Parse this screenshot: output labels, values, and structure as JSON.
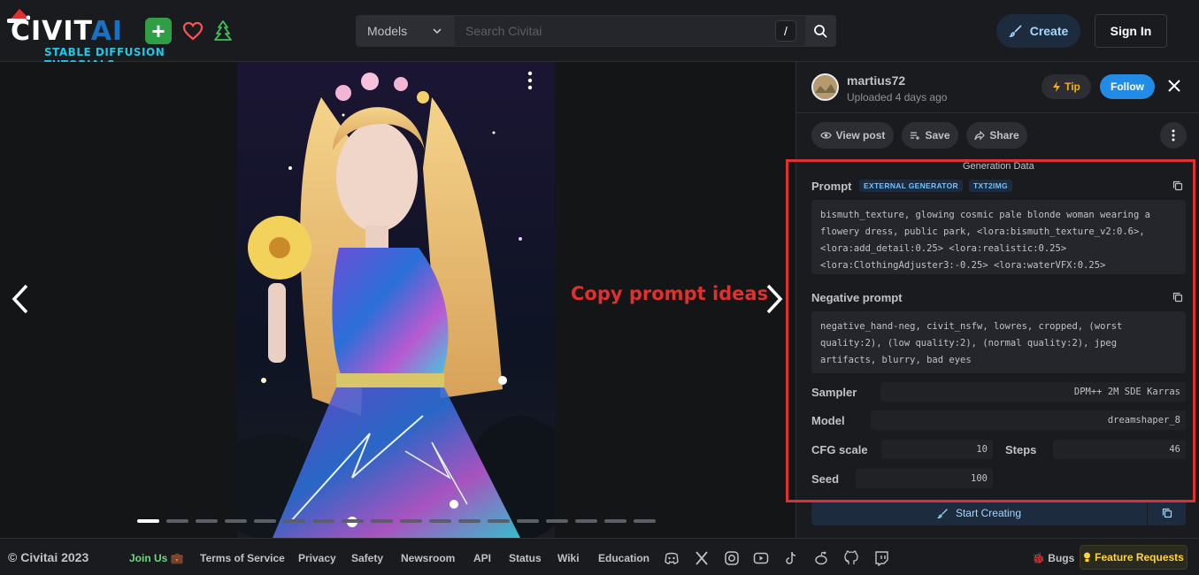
{
  "header": {
    "logo_text_main": "CIVIT",
    "logo_text_ai": "AI",
    "logo_subtitle": "STABLE DIFFUSION TUTORIALS",
    "search_category": "Models",
    "search_placeholder": "Search Civitai",
    "search_shortcut": "/",
    "create_label": "Create",
    "signin_label": "Sign In"
  },
  "viewer": {
    "overlay_text": "Copy prompt ideas",
    "dot_count": 18,
    "active_dot": 0
  },
  "panel": {
    "username": "martius72",
    "uploaded": "Uploaded 4 days ago",
    "tip_label": "Tip",
    "follow_label": "Follow",
    "view_post_label": "View post",
    "save_label": "Save",
    "share_label": "Share",
    "generation_title": "Generation Data",
    "prompt_label": "Prompt",
    "badge_external": "EXTERNAL GENERATOR",
    "badge_txt2img": "TXT2IMG",
    "prompt_lines": [
      "bismuth_texture, glowing cosmic pale blonde woman wearing a",
      "flowery dress, public park, <lora:bismuth_texture_v2:0.6>,",
      "<lora:add_detail:0.25> <lora:realistic:0.25>",
      "<lora:ClothingAdjuster3:-0.25> <lora:waterVFX:0.25>"
    ],
    "negative_label": "Negative prompt",
    "negative_lines": [
      "negative_hand-neg, civit_nsfw, lowres, cropped, (worst",
      "quality:2), (low quality:2), (normal quality:2), jpeg",
      "artifacts, blurry, bad eyes"
    ],
    "sampler_label": "Sampler",
    "sampler_value": "DPM++ 2M SDE Karras",
    "model_label": "Model",
    "model_value": "dreamshaper_8",
    "cfg_label": "CFG scale",
    "cfg_value": "10",
    "steps_label": "Steps",
    "steps_value": "46",
    "seed_label": "Seed",
    "seed_value": "100",
    "start_creating_label": "Start Creating"
  },
  "footer": {
    "copyright": "© Civitai 2023",
    "join_us": "Join Us 💼",
    "links": [
      "Terms of Service",
      "Privacy",
      "Safety",
      "Newsroom",
      "API",
      "Status",
      "Wiki",
      "Education"
    ],
    "bugs": "🐞 Bugs",
    "feature_requests": "Feature Requests"
  },
  "colors": {
    "accent": "#228be6",
    "highlight_frame": "#e03131",
    "tip": "#fab005"
  }
}
